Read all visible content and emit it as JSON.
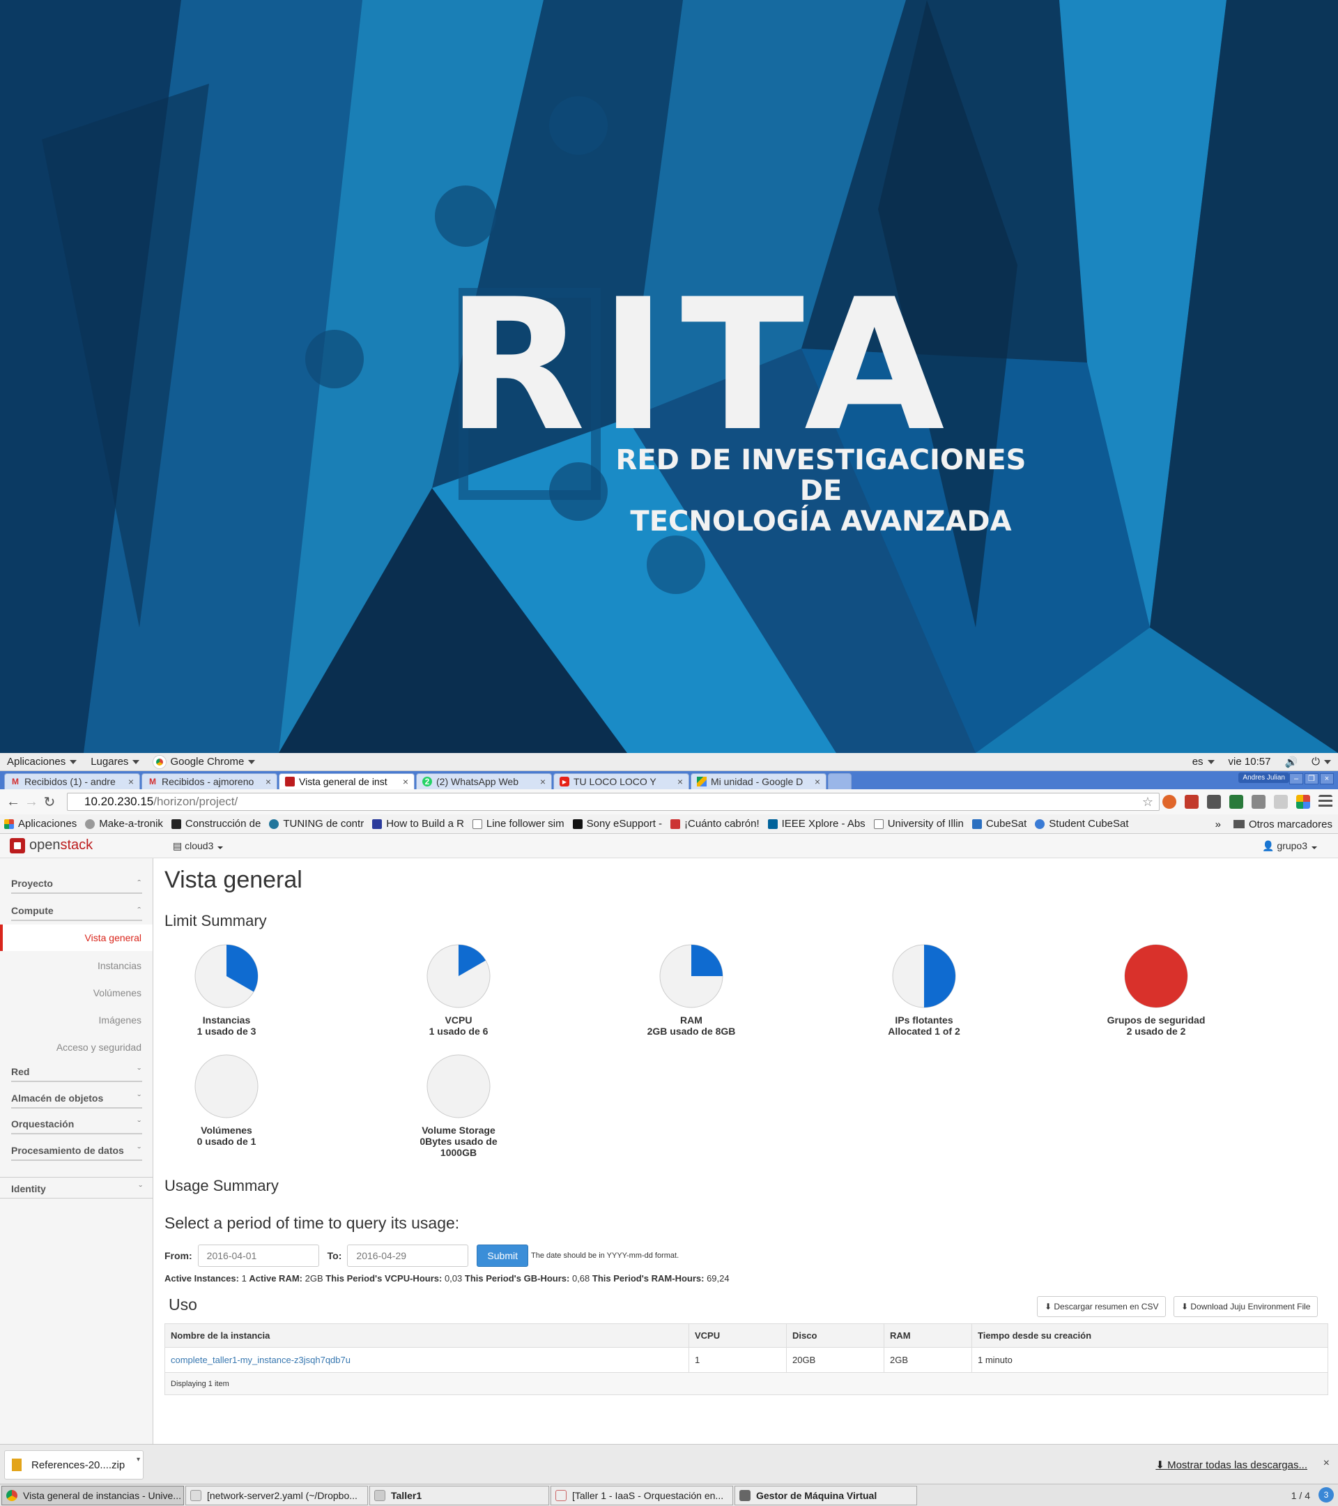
{
  "wallpaper": {
    "title": "RITA",
    "subtitle_line1": "RED DE INVESTIGACIONES DE",
    "subtitle_line2": "TECNOLOGÍA AVANZADA"
  },
  "gnome_bar": {
    "apps": "Aplicaciones",
    "places": "Lugares",
    "browser": "Google Chrome",
    "lang": "es",
    "clock": "vie 10:57"
  },
  "tabs": [
    {
      "title": "Recibidos (1) - andre",
      "icon": "gmail-icon"
    },
    {
      "title": "Recibidos - ajmoreno",
      "icon": "gmail-icon"
    },
    {
      "title": "Vista general de inst",
      "icon": "openstack-icon",
      "active": true
    },
    {
      "title": "(2) WhatsApp Web",
      "icon": "whatsapp-icon"
    },
    {
      "title": "TU LOCO LOCO Y",
      "icon": "youtube-icon"
    },
    {
      "title": "Mi unidad - Google D",
      "icon": "drive-icon"
    }
  ],
  "window_user": "Andres Julian",
  "address": {
    "host": "10.20.230.15",
    "path": "/horizon/project/"
  },
  "bookmarks": [
    "Aplicaciones",
    "Make-a-tronik",
    "Construcción de",
    "TUNING de contr",
    "How to Build a R",
    "Line follower sim",
    "Sony eSupport -",
    "¡Cuánto cabrón!",
    "IEEE Xplore - Abs",
    "University of Illin",
    "CubeSat",
    "Student CubeSat"
  ],
  "bookmarks_other": "Otros marcadores",
  "openstack": {
    "logo_open": "open",
    "logo_stack": "stack",
    "project": "cloud3",
    "user": "grupo3"
  },
  "sidebar": {
    "proyecto": "Proyecto",
    "compute": "Compute",
    "items": [
      "Vista general",
      "Instancias",
      "Volúmenes",
      "Imágenes",
      "Acceso y seguridad"
    ],
    "groups": [
      "Red",
      "Almacén de objetos",
      "Orquestación",
      "Procesamiento de datos"
    ],
    "identity": "Identity"
  },
  "main": {
    "title": "Vista general",
    "limit_summary": "Limit Summary",
    "usage_summary": "Usage Summary",
    "period_question": "Select a period of time to query its usage:",
    "from_label": "From:",
    "from_value": "2016-04-01",
    "to_label": "To:",
    "to_value": "2016-04-29",
    "submit": "Submit",
    "date_hint": "The date should be in YYYY-mm-dd format.",
    "stats": {
      "active_instances_label": "Active Instances:",
      "active_instances": "1",
      "active_ram_label": "Active RAM:",
      "active_ram": "2GB",
      "vcpu_hours_label": "This Period's VCPU-Hours:",
      "vcpu_hours": "0,03",
      "gb_hours_label": "This Period's GB-Hours:",
      "gb_hours": "0,68",
      "ram_hours_label": "This Period's RAM-Hours:",
      "ram_hours": "69,24"
    },
    "uso": "Uso",
    "csv_button": "Descargar resumen en CSV",
    "juju_button": "Download Juju Environment File",
    "table": {
      "headers": [
        "Nombre de la instancia",
        "VCPU",
        "Disco",
        "RAM",
        "Tiempo desde su creación"
      ],
      "rows": [
        [
          "complete_taller1-my_instance-z3jsqh7qdb7u",
          "1",
          "20GB",
          "2GB",
          "1 minuto"
        ]
      ],
      "footer": "Displaying 1 item"
    }
  },
  "chart_data": {
    "type": "pie",
    "charts": [
      {
        "label": "Instancias",
        "caption": "1 usado de 3",
        "used": 1,
        "total": 3
      },
      {
        "label": "VCPU",
        "caption": "1 usado de 6",
        "used": 1,
        "total": 6
      },
      {
        "label": "RAM",
        "caption": "2GB usado de 8GB",
        "used": 2,
        "total": 8
      },
      {
        "label": "IPs flotantes",
        "caption": "Allocated 1 of 2",
        "used": 1,
        "total": 2
      },
      {
        "label": "Grupos de seguridad",
        "caption": "2 usado de 2",
        "used": 2,
        "total": 2
      },
      {
        "label": "Volúmenes",
        "caption": "0 usado de 1",
        "used": 0,
        "total": 1
      },
      {
        "label": "Volume Storage",
        "caption": "0Bytes usado de 1000GB",
        "used": 0,
        "total": 1000
      }
    ],
    "colors": {
      "used": "#0f6bd0",
      "full": "#d9312b",
      "empty": "#f2f2f2"
    }
  },
  "downloads": {
    "file": "References-20....zip",
    "show_all": "Mostrar todas las descargas..."
  },
  "taskbar": {
    "items": [
      "Vista general de instancias - Unive...",
      "[network-server2.yaml (~/Dropbo...",
      "Taller1",
      "[Taller 1 - IaaS - Orquestación en...",
      "Gestor de Máquina Virtual"
    ],
    "pager": "1 / 4",
    "notifications": "3"
  }
}
